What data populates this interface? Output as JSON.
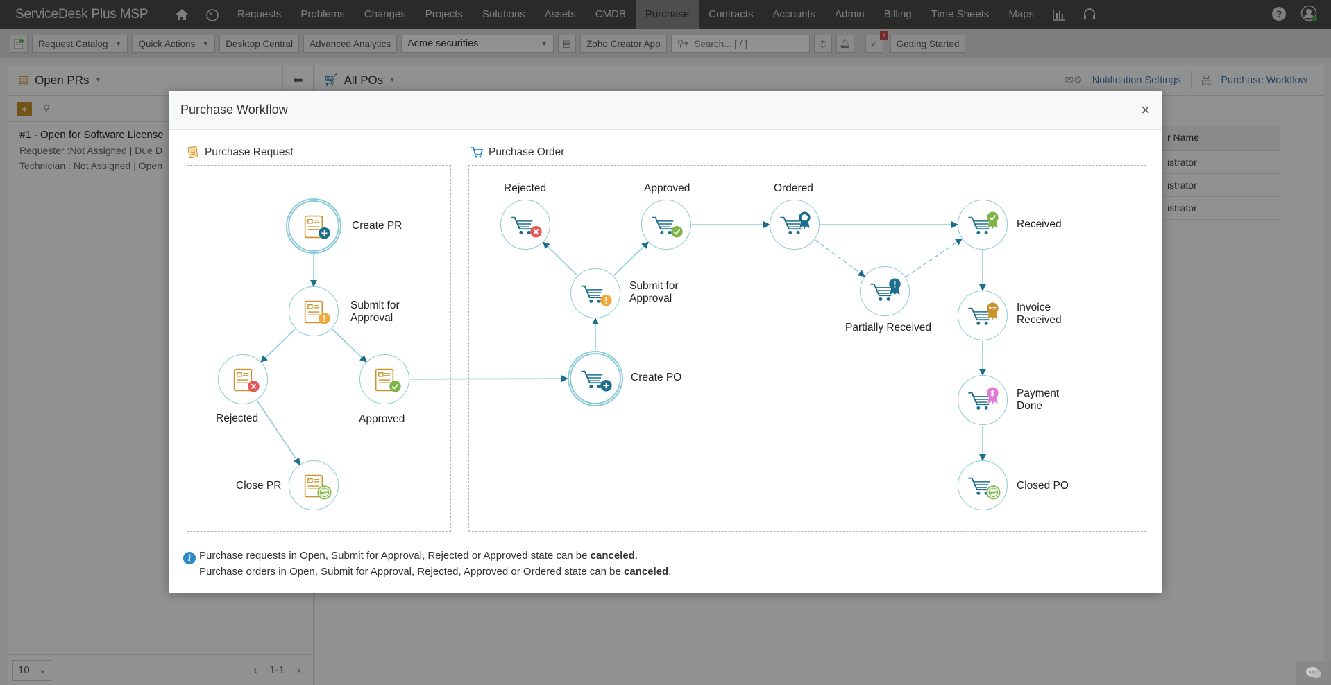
{
  "app": {
    "brand": "ServiceDesk Plus MSP",
    "nav": [
      "Requests",
      "Problems",
      "Changes",
      "Projects",
      "Solutions",
      "Assets",
      "CMDB",
      "Purchase",
      "Contracts",
      "Accounts",
      "Admin",
      "Billing",
      "Time Sheets",
      "Maps"
    ],
    "active_nav": "Purchase"
  },
  "toolbar": {
    "request_catalog": "Request Catalog",
    "quick_actions": "Quick Actions",
    "desktop_central": "Desktop Central",
    "advanced_analytics": "Advanced Analytics",
    "account": "Acme securities",
    "zoho_creator": "Zoho Creator App",
    "search_placeholder": "Search... [ / ]",
    "notification_count": "1",
    "getting_started": "Getting Started"
  },
  "left_pane": {
    "view": "Open PRs",
    "items": [
      {
        "title": "#1 - Open for Software License",
        "requester": "Requester :Not Assigned  |  Due D",
        "technician": "Technician : Not Assigned  |  Open"
      }
    ],
    "per_page": "10",
    "range": "1-1"
  },
  "right_pane": {
    "view": "All POs",
    "notification_settings": "Notification Settings",
    "purchase_workflow": "Purchase Workflow",
    "column_header": "r Name",
    "rows": [
      "istrator",
      "istrator",
      "istrator"
    ]
  },
  "modal": {
    "title": "Purchase Workflow",
    "close": "×",
    "pr_section": "Purchase Request",
    "po_section": "Purchase Order",
    "pr_nodes": {
      "create": "Create PR",
      "submit": [
        "Submit for",
        "Approval"
      ],
      "rejected": "Rejected",
      "approved": "Approved",
      "close": "Close PR"
    },
    "po_nodes": {
      "create": "Create PO",
      "submit": [
        "Submit for",
        "Approval"
      ],
      "rejected": "Rejected",
      "approved": "Approved",
      "ordered": "Ordered",
      "partial": "Partially Received",
      "received": "Received",
      "invoice": [
        "Invoice",
        "Received"
      ],
      "payment": [
        "Payment",
        "Done"
      ],
      "closed": "Closed PO"
    },
    "note": {
      "line1_prefix": "Purchase requests in Open, Submit for Approval, Rejected or Approved state can be ",
      "line2_prefix": "Purchase orders in Open, Submit for Approval, Rejected, Approved or Ordered state can be ",
      "emphasis": "canceled",
      "suffix": "."
    },
    "colors": {
      "doc": "#c9922b",
      "cart": "#1c6e8c",
      "node_border": "#8ccbd8",
      "reject": "#e45a5a",
      "approve": "#7db548",
      "warn": "#f0a93a",
      "payment": "#e07ad8",
      "create": "#1c6e8c"
    }
  }
}
